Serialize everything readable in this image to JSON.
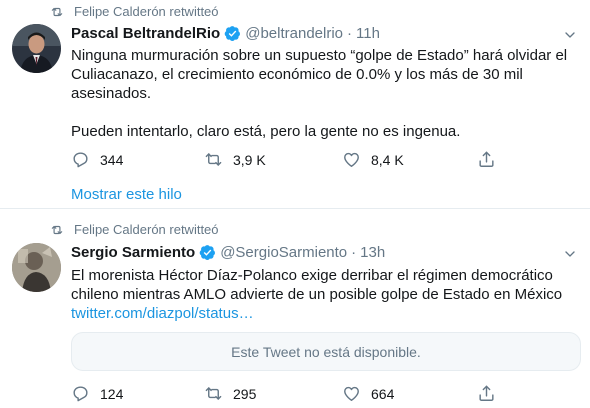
{
  "tweets": [
    {
      "retweeted_by": "Felipe Calderón retwitteó",
      "name": "Pascal BeltrandelRio",
      "handle": "@beltrandelrio",
      "dot": "·",
      "time": "11h",
      "text": "Ninguna murmuración sobre un supuesto “golpe de Estado” hará olvidar el\nCuliacanazo, el crecimiento económico de 0.0% y los más de 30 mil\nasesinados.\n\nPueden intentarlo, claro está, pero la gente no es ingenua.",
      "replies": "344",
      "retweets": "3,9 K",
      "likes": "8,4 K",
      "show_thread": "Mostrar este hilo"
    },
    {
      "retweeted_by": "Felipe Calderón retwitteó",
      "name": "Sergio Sarmiento",
      "handle": "@SergioSarmiento",
      "dot": "·",
      "time": "13h",
      "text": "El morenista Héctor Díaz-Polanco exige derribar el régimen democrático\nchileno mientras AMLO advierte de un posible golpe de Estado en México",
      "link": "twitter.com/diazpol/status…",
      "unavailable": "Este Tweet no está disponible.",
      "replies": "124",
      "retweets": "295",
      "likes": "664"
    }
  ],
  "colors": {
    "accent": "#1da1f2",
    "link": "#1b95e0",
    "muted": "#657786",
    "text": "#14171a"
  },
  "icons": [
    "retweet-icon",
    "verified-badge-icon",
    "chevron-down-icon",
    "reply-icon",
    "like-icon",
    "share-icon"
  ]
}
